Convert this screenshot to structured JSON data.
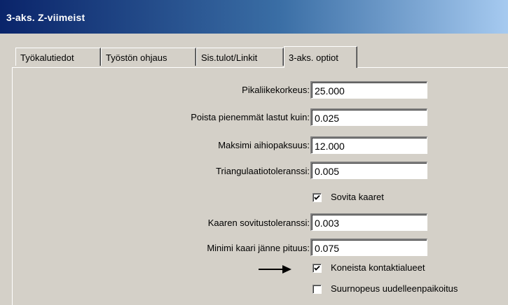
{
  "window": {
    "title": "3-aks. Z-viimeist"
  },
  "tabs": [
    {
      "label": "Työkalutiedot"
    },
    {
      "label": "Työstön ohjaus"
    },
    {
      "label": "Sis.tulot/Linkit"
    },
    {
      "label": "3-aks. optiot"
    }
  ],
  "fields": {
    "rapid_height": {
      "label": "Pikaliikekorkeus:",
      "value": "25.000"
    },
    "remove_smaller_chips": {
      "label": "Poista pienemmät lastut kuin:",
      "value": "0.025"
    },
    "max_stock_thickness": {
      "label": "Maksimi aihiopaksuus:",
      "value": "12.000"
    },
    "triangulation_tolerance": {
      "label": "Triangulaatiotoleranssi:",
      "value": "0.005"
    },
    "arc_fit_tolerance": {
      "label": "Kaaren sovitustoleranssi:",
      "value": "0.003"
    },
    "min_arc_chord": {
      "label": "Minimi kaari jänne pituus:",
      "value": "0.075"
    }
  },
  "checkboxes": {
    "fit_arcs": {
      "label": "Sovita kaaret",
      "checked": true
    },
    "machine_contact_areas": {
      "label": "Koneista kontaktialueet",
      "checked": true
    },
    "high_speed_reposition": {
      "label": "Suurnopeus uudelleenpaikoitus",
      "checked": false
    }
  },
  "icons": {
    "pointer": "right-arrow-icon",
    "check": "checkmark-icon"
  }
}
